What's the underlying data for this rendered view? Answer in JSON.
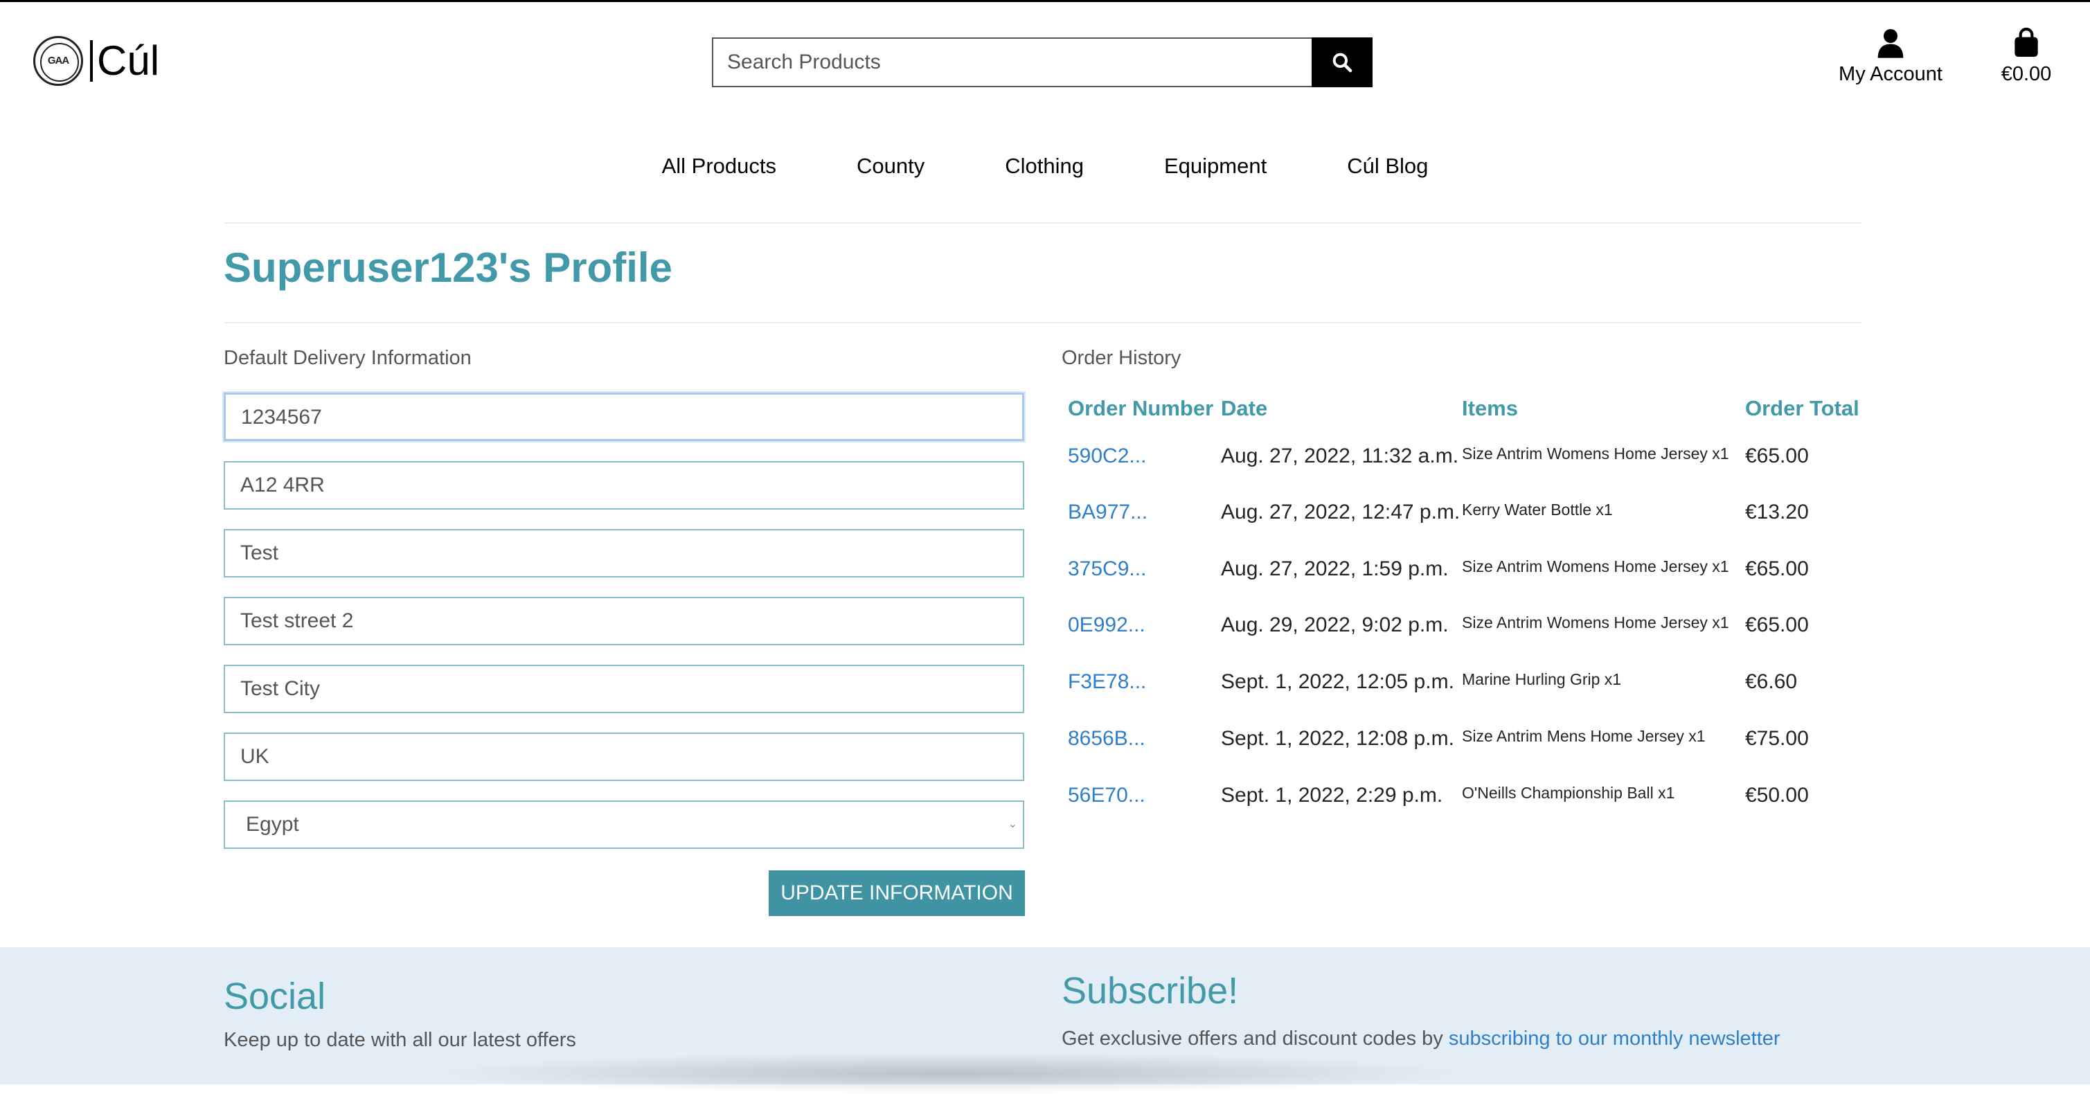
{
  "brand": {
    "emblem_text": "GAA",
    "name": "Cúl"
  },
  "search": {
    "placeholder": "Search Products"
  },
  "header": {
    "account_label": "My Account",
    "cart_total": "€0.00"
  },
  "nav": [
    "All Products",
    "County",
    "Clothing",
    "Equipment",
    "Cúl Blog"
  ],
  "profile": {
    "title": "Superuser123's Profile"
  },
  "delivery": {
    "label": "Default Delivery Information",
    "fields": [
      "1234567",
      "A12 4RR",
      "Test",
      "Test street 2",
      "Test City",
      "UK"
    ],
    "country": "Egypt",
    "button": "UPDATE INFORMATION"
  },
  "order_history": {
    "label": "Order History",
    "headers": [
      "Order Number",
      "Date",
      "Items",
      "Order Total"
    ],
    "rows": [
      {
        "number": "590C2...",
        "date": "Aug. 27, 2022, 11:32 a.m.",
        "items": "Size Antrim Womens Home Jersey x1",
        "total": "€65.00"
      },
      {
        "number": "BA977...",
        "date": "Aug. 27, 2022, 12:47 p.m.",
        "items": "Kerry Water Bottle x1",
        "total": "€13.20"
      },
      {
        "number": "375C9...",
        "date": "Aug. 27, 2022, 1:59 p.m.",
        "items": "Size Antrim Womens Home Jersey x1",
        "total": "€65.00"
      },
      {
        "number": "0E992...",
        "date": "Aug. 29, 2022, 9:02 p.m.",
        "items": "Size Antrim Womens Home Jersey x1",
        "total": "€65.00"
      },
      {
        "number": "F3E78...",
        "date": "Sept. 1, 2022, 12:05 p.m.",
        "items": "Marine Hurling Grip x1",
        "total": "€6.60"
      },
      {
        "number": "8656B...",
        "date": "Sept. 1, 2022, 12:08 p.m.",
        "items": "Size Antrim Mens Home Jersey x1",
        "total": "€75.00"
      },
      {
        "number": "56E70...",
        "date": "Sept. 1, 2022, 2:29 p.m.",
        "items": "O'Neills Championship Ball x1",
        "total": "€50.00"
      }
    ]
  },
  "footer": {
    "social_title": "Social",
    "social_text": "Keep up to date with all our latest offers",
    "subscribe_title": "Subscribe!",
    "subscribe_text": "Get exclusive offers and discount codes by ",
    "subscribe_link": "subscribing to our monthly newsletter"
  },
  "colors": {
    "accent": "#4199a9",
    "button": "#3f93a3",
    "link": "#2f7fc8",
    "footer_bg": "#e3edf5"
  }
}
